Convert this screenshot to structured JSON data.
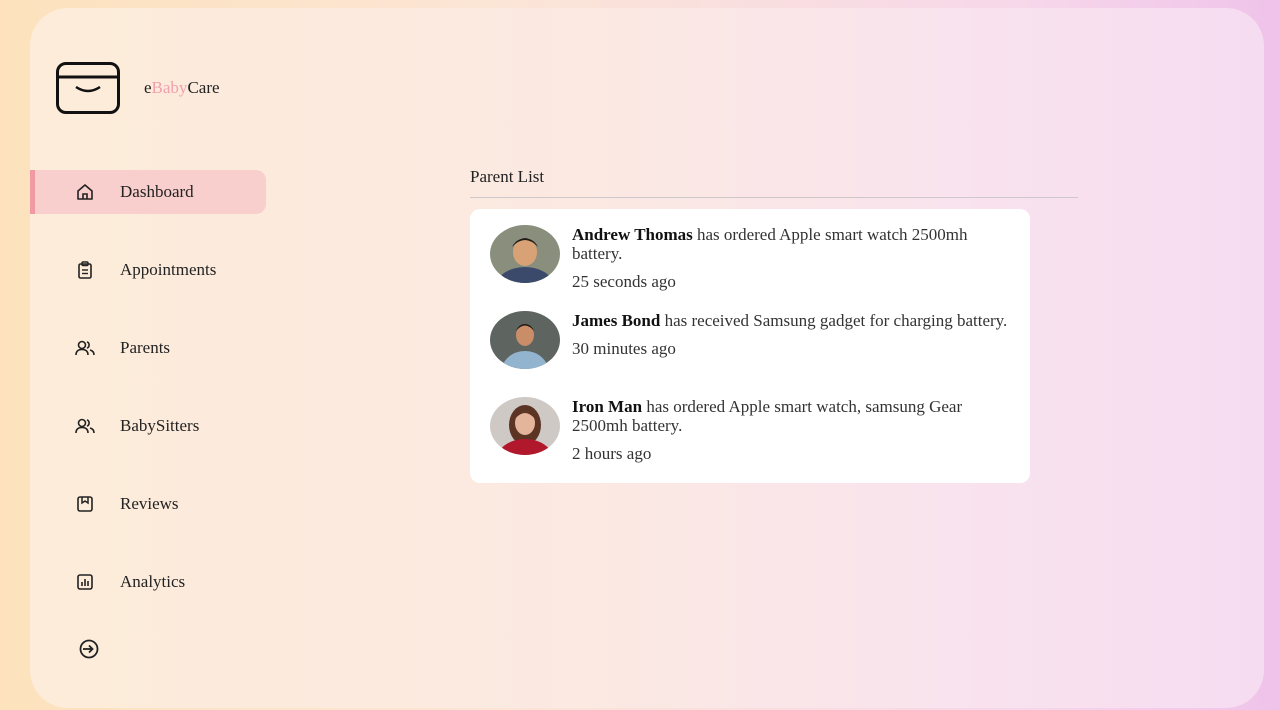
{
  "brand": {
    "prefix": "e",
    "accent": "Baby",
    "suffix": "Care",
    "accent_color": "#f0a0ae"
  },
  "nav": {
    "items": [
      {
        "label": "Dashboard",
        "icon": "home-icon",
        "active": true
      },
      {
        "label": "Appointments",
        "icon": "clipboard-icon"
      },
      {
        "label": "Parents",
        "icon": "users-icon"
      },
      {
        "label": "BabySitters",
        "icon": "users-icon"
      },
      {
        "label": "Reviews",
        "icon": "bookmark-box-icon"
      },
      {
        "label": "Analytics",
        "icon": "bar-chart-icon"
      }
    ],
    "logout_icon": "logout-icon"
  },
  "main": {
    "section_title": "Parent List",
    "activities": [
      {
        "name": "Andrew Thomas",
        "message": " has ordered Apple smart watch 2500mh battery.",
        "time": "25 seconds ago"
      },
      {
        "name": "James Bond",
        "message": " has received Samsung gadget for charging battery.",
        "time": "30 minutes ago"
      },
      {
        "name": "Iron Man",
        "message": " has ordered Apple smart watch, samsung Gear 2500mh battery.",
        "time": "2 hours ago"
      }
    ]
  }
}
